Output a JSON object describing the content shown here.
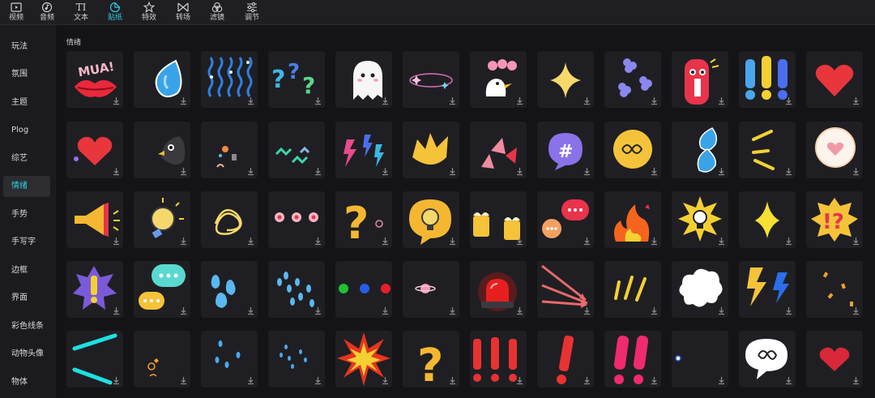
{
  "toolbar": {
    "tabs": [
      {
        "label": "视频",
        "icon": "video-icon"
      },
      {
        "label": "音频",
        "icon": "audio-icon"
      },
      {
        "label": "文本",
        "icon": "text-icon"
      },
      {
        "label": "贴纸",
        "icon": "sticker-icon",
        "active": true
      },
      {
        "label": "特效",
        "icon": "effects-icon"
      },
      {
        "label": "转场",
        "icon": "transition-icon"
      },
      {
        "label": "滤镜",
        "icon": "filter-icon"
      },
      {
        "label": "调节",
        "icon": "adjust-icon"
      }
    ],
    "text_icon_glyph": "TI"
  },
  "sidebar": {
    "items": [
      {
        "label": "玩法"
      },
      {
        "label": "氛围"
      },
      {
        "label": "主题"
      },
      {
        "label": "Plog"
      },
      {
        "label": "综艺"
      },
      {
        "label": "情绪",
        "active": true
      },
      {
        "label": "手势"
      },
      {
        "label": "手写字"
      },
      {
        "label": "边框"
      },
      {
        "label": "界面"
      },
      {
        "label": "彩色线条"
      },
      {
        "label": "动物头像"
      },
      {
        "label": "物体"
      }
    ]
  },
  "section": {
    "title": "情绪"
  },
  "stickers": {
    "mua_text": "MUA!",
    "rows": [
      [
        "lips-mua",
        "water-drop",
        "wavy-lines",
        "question-marks",
        "ghost",
        "sparkle-ring",
        "duck-eee",
        "four-point-star",
        "purple-flowers",
        "red-tag-face",
        "exclamation-bars",
        "heart"
      ],
      [
        "heart-broken",
        "black-bird",
        "small-doodles",
        "zigzag-lines",
        "lightning-bolts",
        "burst-yellow",
        "pink-shards",
        "hash-bubble",
        "scribble-bubble",
        "blue-drops",
        "angle-lines",
        "heart-bubble"
      ],
      [
        "megaphone",
        "light-bulb",
        "scribble-ball",
        "pink-dots",
        "question-orange",
        "bulb-bubble",
        "beer-mugs",
        "chat-bubbles",
        "fire",
        "bulb-burst",
        "yellow-star",
        "exclamation-question-burst"
      ],
      [
        "exclamation-burst",
        "dots-bubbles",
        "blue-drops-three",
        "blue-drops-many",
        "rgb-dots",
        "pink-planet",
        "red-alarm",
        "arrows",
        "yellow-lines",
        "cloud-puff",
        "lightning-pair",
        "orange-confetti"
      ],
      [
        "cyan-lines",
        "orange-doodles",
        "blue-small-drops",
        "blue-tiny-drops",
        "explosion",
        "question-yellow",
        "red-exclamations",
        "single-exclamation",
        "pink-exclamations",
        "white-dot",
        "scribble-speech",
        "heart-small"
      ]
    ]
  },
  "colors": {
    "accent": "#2fcde0",
    "panel": "#1f1f23",
    "background": "#141417",
    "sidebar": "#1b1b1f"
  }
}
